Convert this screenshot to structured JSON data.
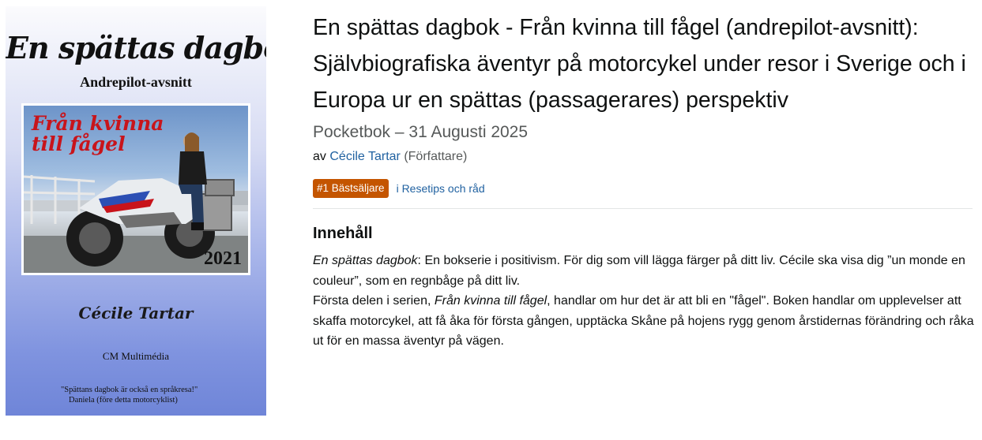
{
  "cover": {
    "title": "En spättas dagbok",
    "subtitle": "Andrepilot-avsnitt",
    "photo_title_line1": "Från kvinna",
    "photo_title_line2": "till fågel",
    "year": "2021",
    "author": "Cécile Tartar",
    "publisher": "CM Multimédia",
    "quote_line1": "\"Spättans dagbok är också en språkresa!\"",
    "quote_line2": "Daniela (före detta motorcyklist)"
  },
  "product": {
    "title": "En spättas dagbok - Från kvinna till fågel (andrepilot-avsnitt): Självbiografiska äventyr på motorcykel under resor i Sverige och i Europa ur en spättas (passagerares) perspektiv",
    "format": "Pocketbok – 31 Augusti 2025",
    "by_prefix": "av",
    "author_name": "Cécile Tartar",
    "author_role": "(Författare)",
    "badge": "#1 Bästsäljare",
    "badge_category": "i Resetips och råd"
  },
  "content_section": {
    "heading": "Innehåll",
    "p1_italic": "En spättas dagbok",
    "p1_rest": ": En bokserie i positivism. För dig som vill lägga färger på ditt liv. Cécile ska visa dig ”un monde en couleur”, som en regnbåge på ditt liv.",
    "p2_start": "Första delen i serien, ",
    "p2_italic": "Från kvinna till fågel",
    "p2_rest": ", handlar om hur det är att bli en \"fågel\". Boken handlar om upplevelser att skaffa motorcykel, att få åka för första gången, upptäcka Skåne på hojens rygg genom årstidernas förändring och råka ut för en massa äventyr på vägen."
  },
  "colors": {
    "link": "#2162a1",
    "badge_bg": "#c45500",
    "muted_text": "#565959",
    "cover_title_red": "#c8141b"
  }
}
